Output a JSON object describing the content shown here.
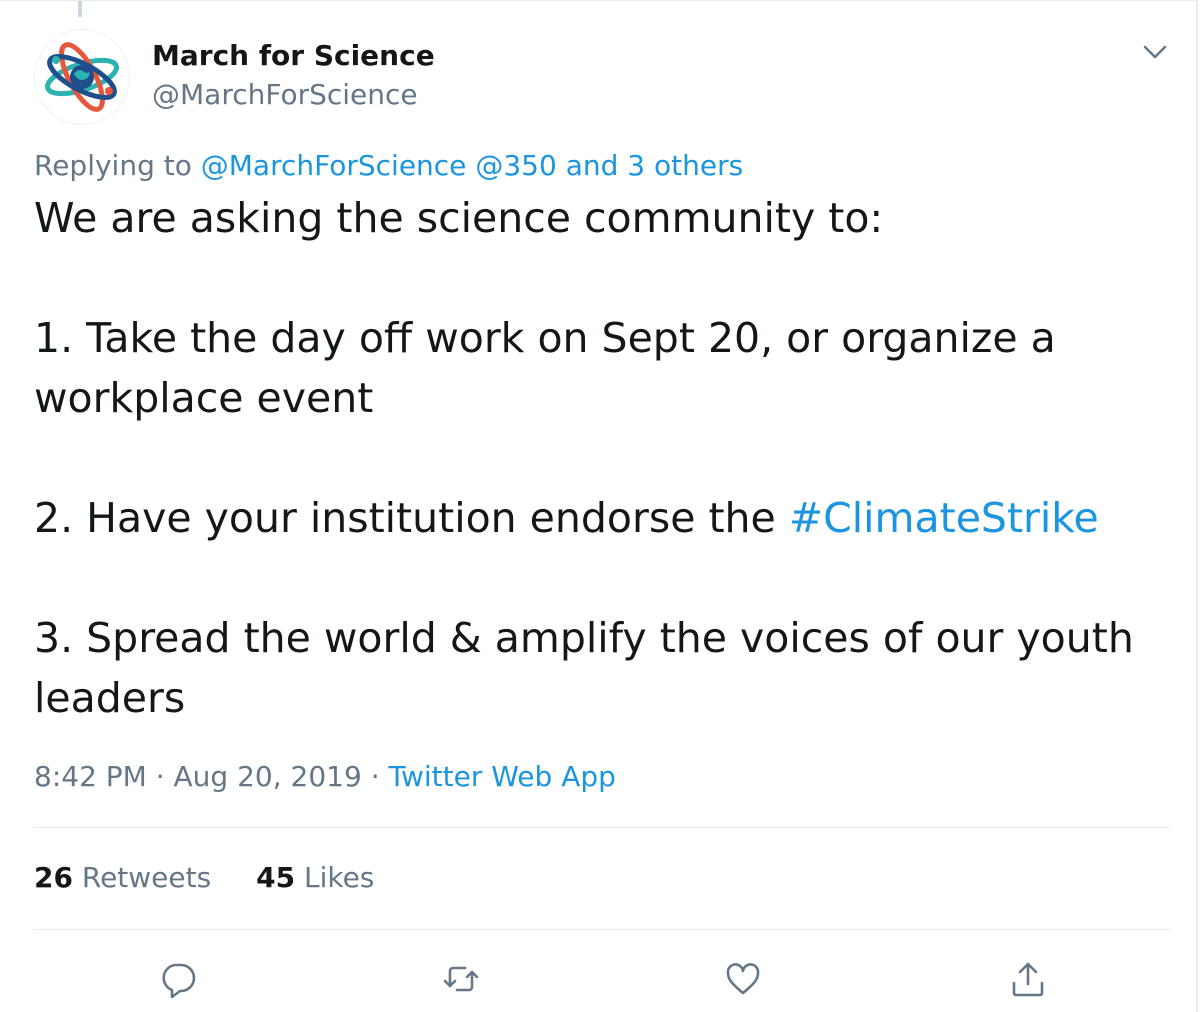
{
  "author": {
    "name": "March for Science",
    "handle": "@MarchForScience",
    "avatar_icon": "atom-globe-logo"
  },
  "reply_context": {
    "prefix": "Replying to",
    "mentions": [
      "@MarchForScience",
      "@350"
    ],
    "others": "and 3 others"
  },
  "body": {
    "intro": "We are asking the science community to:",
    "item1": "1. Take the day off work on Sept 20, or organize a workplace event",
    "item2_text": "2. Have your institution endorse the ",
    "item2_hashtag": "#ClimateStrike",
    "item3": "3. Spread the world & amplify the voices of our youth leaders"
  },
  "meta": {
    "time": "8:42 PM",
    "separator": " · ",
    "date": "Aug 20, 2019",
    "source": "Twitter Web App"
  },
  "stats": {
    "retweets_count": "26",
    "retweets_label": "Retweets",
    "likes_count": "45",
    "likes_label": "Likes"
  },
  "colors": {
    "link": "#1b95e0",
    "secondary_text": "#657786",
    "primary_text": "#14171a",
    "divider": "#e6ecf0"
  },
  "icons": {
    "menu": "chevron-down-icon",
    "reply": "reply-icon",
    "retweet": "retweet-icon",
    "like": "heart-icon",
    "share": "share-icon"
  }
}
